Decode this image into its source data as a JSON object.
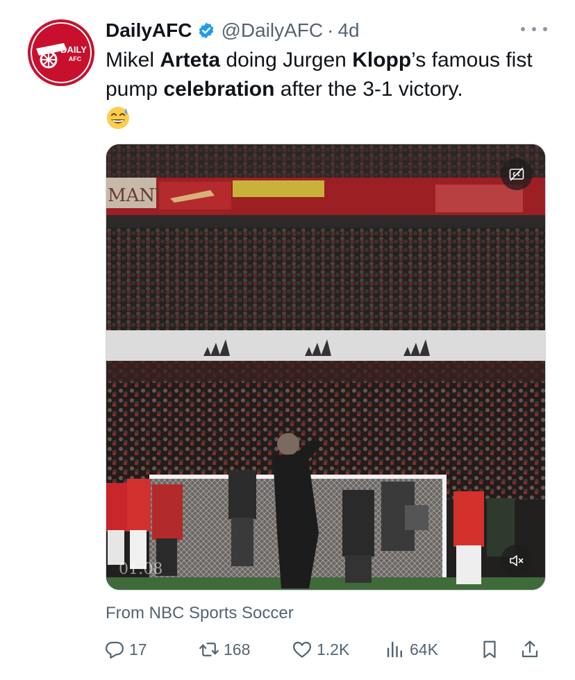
{
  "author": {
    "display_name": "DailyAFC",
    "handle": "@DailyAFC",
    "separator": "·",
    "time": "4d",
    "verified_color": "#1d9bf0",
    "avatar_logo_text": "DAILY AFC"
  },
  "tweet": {
    "segments": [
      {
        "text": "Mikel ",
        "bold": false
      },
      {
        "text": "Arteta",
        "bold": true
      },
      {
        "text": " doing Jurgen ",
        "bold": false
      },
      {
        "text": "Klopp",
        "bold": true
      },
      {
        "text": "’s famous fist pump ",
        "bold": false
      },
      {
        "text": "celebration",
        "bold": true
      },
      {
        "text": " after the 3-1 victory.",
        "bold": false
      }
    ],
    "emoji": "grinning-face-with-sweat"
  },
  "media": {
    "board_text": "MANY",
    "timestamp": "01:08",
    "cc_icon": "captions-icon",
    "mute_icon": "muted-speaker-icon"
  },
  "source": "From NBC Sports Soccer",
  "actions": {
    "replies": "17",
    "reposts": "168",
    "likes": "1.2K",
    "views": "64K"
  },
  "colors": {
    "text": "#0f1419",
    "secondary": "#536471",
    "arsenal_red": "#c8102e"
  }
}
